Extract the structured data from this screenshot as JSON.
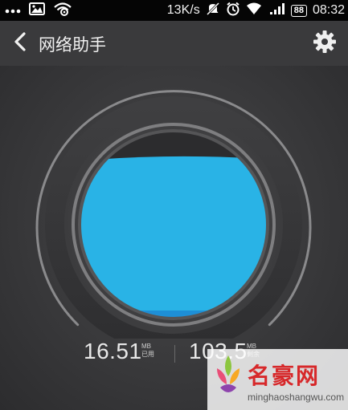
{
  "status_bar": {
    "icons_left": [
      "more-dots-icon",
      "image-icon",
      "wifi-signal-icon"
    ],
    "net_speed": "13K/s",
    "icons_right": [
      "mute-icon",
      "alarm-icon",
      "wifi-icon",
      "cellular-signal-icon"
    ],
    "battery": "88",
    "time": "08:32"
  },
  "app_bar": {
    "title": "网络助手",
    "back_icon": "chevron-left-icon",
    "settings_icon": "gear-icon"
  },
  "usage": {
    "used_value": "16.51",
    "used_unit": "MB",
    "used_label": "已用",
    "remaining_value": "103.5",
    "remaining_unit": "MB",
    "remaining_label": "剩余",
    "fill_fraction": 0.86,
    "fill_color": "#29b3e6"
  },
  "watermark": {
    "name": "名豪网",
    "url": "minghaoshangwu.com"
  },
  "colors": {
    "background": "#3a3a3c",
    "status_bar": "#050505",
    "accent": "#29b3e6"
  }
}
